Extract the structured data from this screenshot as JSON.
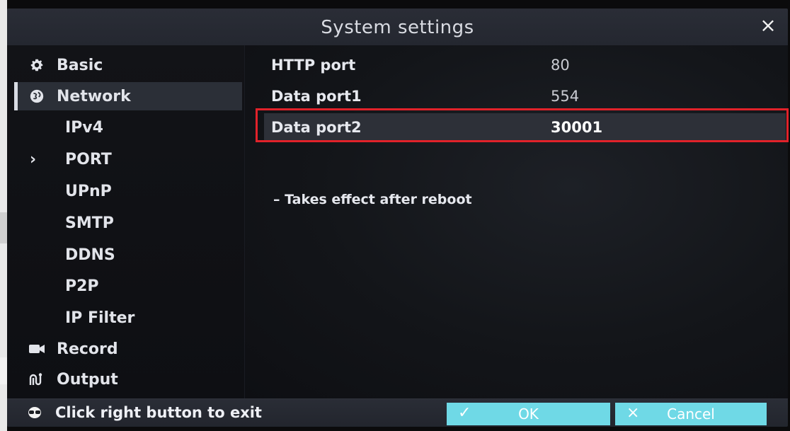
{
  "window": {
    "title": "System settings",
    "close_icon": "close-icon"
  },
  "sidebar": {
    "items": [
      {
        "label": "Basic",
        "icon": "gear-icon",
        "level": "top"
      },
      {
        "label": "Network",
        "icon": "globe-icon",
        "level": "top",
        "state": "expanded"
      },
      {
        "label": "IPv4",
        "level": "sub"
      },
      {
        "label": "PORT",
        "level": "sub",
        "state": "current"
      },
      {
        "label": "UPnP",
        "level": "sub"
      },
      {
        "label": "SMTP",
        "level": "sub"
      },
      {
        "label": "DDNS",
        "level": "sub"
      },
      {
        "label": "P2P",
        "level": "sub"
      },
      {
        "label": "IP Filter",
        "level": "sub"
      },
      {
        "label": "Record",
        "icon": "camera-icon",
        "level": "top"
      },
      {
        "label": "Output",
        "icon": "output-icon",
        "level": "top"
      }
    ]
  },
  "port_settings": {
    "fields": [
      {
        "label": "HTTP port",
        "value": "80"
      },
      {
        "label": "Data port1",
        "value": "554"
      },
      {
        "label": "Data port2",
        "value": "30001"
      }
    ],
    "note": "– Takes effect after reboot"
  },
  "footer": {
    "hint": "Click right button to exit",
    "hint_icon": "mouse-icon",
    "ok_label": "OK",
    "cancel_label": "Cancel",
    "ok_icon": "check-icon",
    "cancel_icon": "x-icon"
  },
  "colors": {
    "accent_button": "#6fd9e6",
    "highlight_outline": "#e1222a",
    "background": "#0b0b0c",
    "text": "#e2e4ea"
  }
}
